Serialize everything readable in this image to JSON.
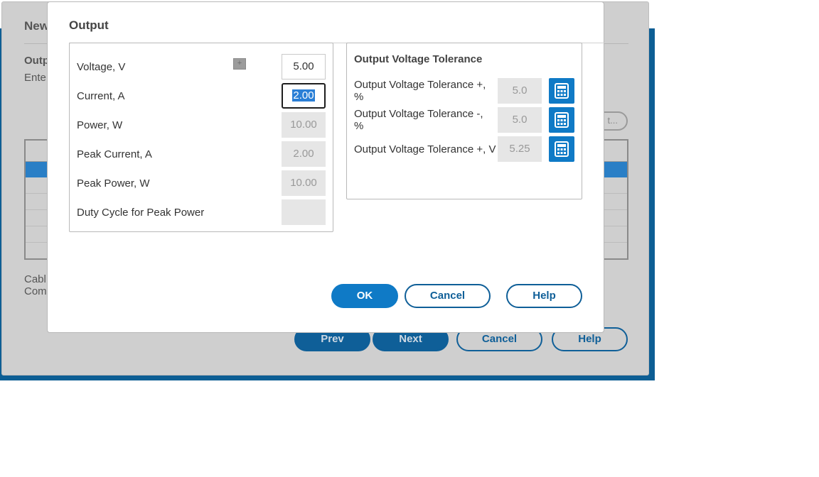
{
  "background_window": {
    "title": "New",
    "section": "Outp",
    "description": "Ente",
    "pill_label": "t...",
    "footer_line1": "Cabl",
    "footer_line2": "Comp",
    "buttons": {
      "prev": "Prev",
      "next": "Next",
      "cancel": "Cancel",
      "help": "Help"
    }
  },
  "dialog": {
    "title": "Output",
    "fields": [
      {
        "label": "Voltage, V",
        "value": "5.00"
      },
      {
        "label": "Current, A",
        "value": "2.00"
      },
      {
        "label": "Power, W",
        "value": "10.00"
      },
      {
        "label": "Peak Current, A",
        "value": "2.00"
      },
      {
        "label": "Peak Power, W",
        "value": "10.00"
      },
      {
        "label": "Duty Cycle for Peak Power",
        "value": ""
      }
    ],
    "voltage_mini_button": "+",
    "tolerance": {
      "title": "Output Voltage Tolerance",
      "rows": [
        {
          "label_line1": "Output Voltage Tolerance +,",
          "label_line2": "%",
          "value": "5.0",
          "icon": "calculator-icon"
        },
        {
          "label_line1": "Output Voltage Tolerance -,",
          "label_line2": "%",
          "value": "5.0",
          "icon": "calculator-icon"
        },
        {
          "label_line1": "Output Voltage Tolerance +, V",
          "label_line2": "",
          "value": "5.25",
          "icon": "calculator-icon"
        }
      ]
    },
    "buttons": {
      "ok": "OK",
      "cancel": "Cancel",
      "help": "Help"
    }
  },
  "colors": {
    "accent": "#0f7ac6",
    "dark_accent": "#0f5f98",
    "selection": "#2a7fd6"
  }
}
